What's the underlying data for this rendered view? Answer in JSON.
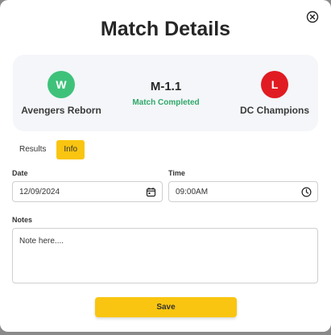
{
  "modal": {
    "title": "Match Details",
    "close_icon": "close-circle-icon"
  },
  "summary": {
    "team_left": {
      "badge": "W",
      "name": "Avengers Reborn",
      "badge_color": "#3ec27a"
    },
    "team_right": {
      "badge": "L",
      "name": "DC Champions",
      "badge_color": "#e11b22"
    },
    "match_code": "M-1.1",
    "status": "Match Completed",
    "status_color": "#2fa86a"
  },
  "tabs": [
    {
      "label": "Results",
      "active": false
    },
    {
      "label": "Info",
      "active": true
    }
  ],
  "form": {
    "date": {
      "label": "Date",
      "value": "12/09/2024",
      "icon": "calendar-icon"
    },
    "time": {
      "label": "Time",
      "value": "09:00AM",
      "icon": "clock-icon"
    },
    "notes": {
      "label": "Notes",
      "value": "Note here...."
    }
  },
  "save_button": {
    "label": "Save"
  },
  "colors": {
    "accent": "#f9c510"
  }
}
